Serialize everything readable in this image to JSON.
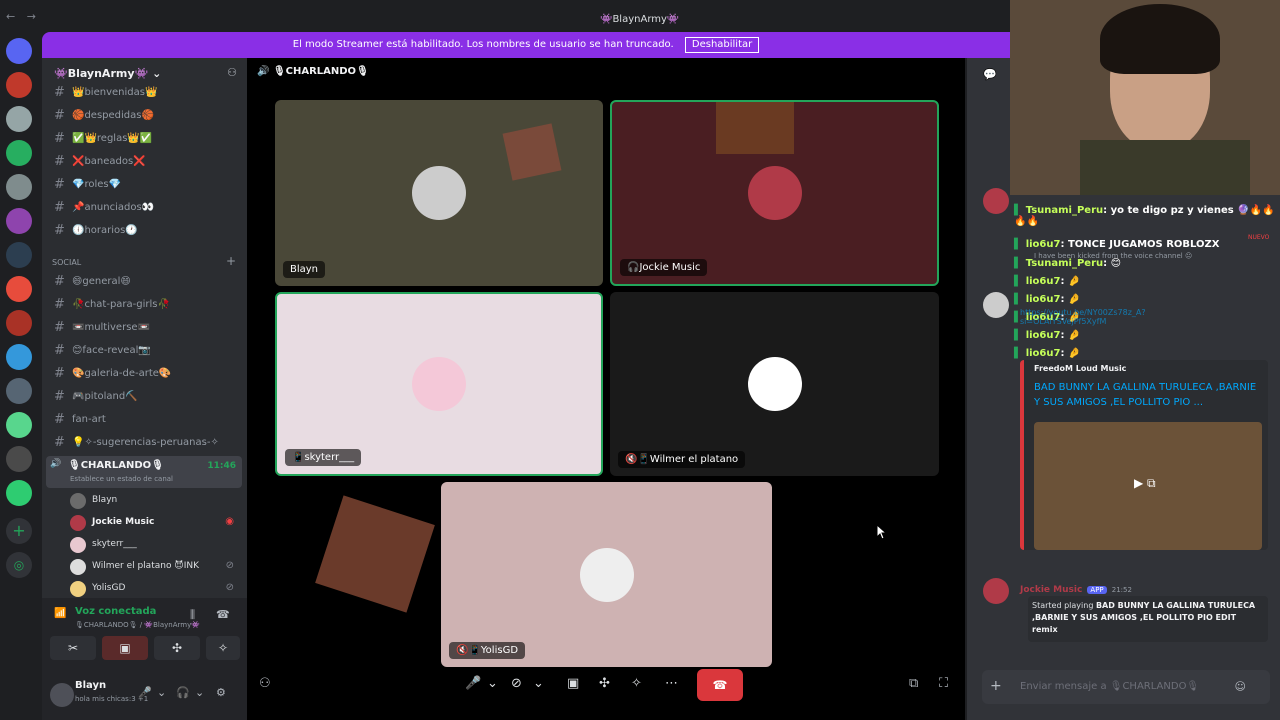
{
  "titlebar": {
    "title": "👾BlaynArmy👾",
    "nav": "← →"
  },
  "banner": {
    "text": "El modo Streamer está habilitado. Los nombres de usuario se han truncado.",
    "button": "Deshabilitar"
  },
  "server": {
    "name": "👾BlaynArmy👾"
  },
  "channels": [
    {
      "label": "👑bienvenidas👑",
      "icon": "hash-icon"
    },
    {
      "label": "🏀despedidas🏀",
      "icon": "hash-icon"
    },
    {
      "label": "✅👑reglas👑✅",
      "icon": "hash-icon"
    },
    {
      "label": "❌baneados❌",
      "icon": "hash-icon"
    },
    {
      "label": "💎roles💎",
      "icon": "hash-icon"
    },
    {
      "label": "📌anunciados👀",
      "icon": "hash-icon"
    },
    {
      "label": "🕕horarios🕐",
      "icon": "hash-icon"
    }
  ],
  "category_social": "SOCIAL",
  "social_channels": [
    {
      "label": "😄general😄",
      "icon": "hash-icon"
    },
    {
      "label": "🥀chat-para-girls🥀",
      "icon": "hash-icon"
    },
    {
      "label": "📼multiverse📼",
      "icon": "hash-icon"
    },
    {
      "label": "😊face-reveal📷",
      "icon": "hash-icon"
    },
    {
      "label": "🎨galeria-de-arte🎨",
      "icon": "hash-icon"
    },
    {
      "label": "🎮pitoland⛏️",
      "icon": "hash-icon"
    },
    {
      "label": "fan-art",
      "icon": "hash-icon"
    },
    {
      "label": "💡✧-sugerencias-peruanas-✧",
      "icon": "hash-icon"
    }
  ],
  "voice_channel": {
    "name": "🎙CHARLANDO🎙",
    "time": "11:46",
    "status": "Establece un estado de canal",
    "users": [
      {
        "name": "Blayn"
      },
      {
        "name": "Jockie Music"
      },
      {
        "name": "skyterr___"
      },
      {
        "name": "Wilmer el platano 😈INK"
      },
      {
        "name": "YolisGD"
      }
    ]
  },
  "voicebar": {
    "label": "Voz conectada",
    "sub": "🎙CHARLANDO🎙 / 👾BlaynArmy👾"
  },
  "userbar": {
    "name": "Blayn",
    "status": "hola mis chicas:3 +1"
  },
  "stage": {
    "header": "🎙CHARLANDO🎙",
    "tiles": [
      {
        "label": "Blayn"
      },
      {
        "label": "🎧Jockie Music"
      },
      {
        "label": "📱skyterr___"
      },
      {
        "label": "🔇📱Wilmer el platano"
      },
      {
        "label": "🔇📱YolisGD"
      }
    ]
  },
  "overlay_chat": [
    {
      "user": "Tsunami_Peru",
      "text": ": yo te digo pz y vienes 🔮🔥🔥🔥🔥"
    },
    {
      "user": "lio6u7",
      "text": ": TONCE JUGAMOS ROBLOZX"
    },
    {
      "user": "Tsunami_Peru",
      "text": ": 😊"
    },
    {
      "user": "lio6u7",
      "text": ": 🤌"
    },
    {
      "user": "lio6u7",
      "text": ": 🤌"
    },
    {
      "user": "lio6u7",
      "text": ": 🤌"
    },
    {
      "user": "lio6u7",
      "text": ": 🤌"
    },
    {
      "user": "lio6u7",
      "text": ": 🤌"
    }
  ],
  "chat_faded": {
    "kicked": "I have been kicked from the voice channel 😐",
    "link": "https://youtu.be/NY00Zs78z_A?si=OLAiYSVejPf5XyfM",
    "new_badge": "NUEVO"
  },
  "embed": {
    "provider": "FreedoM Loud Music",
    "title": "BAD BUNNY LA GALLINA TURULECA ,BARNIE Y SUS AMIGOS ,EL POLLITO PIO ..."
  },
  "bot_msg": {
    "name": "Jockie Music",
    "badge": "APP",
    "time": "21:52",
    "text_prefix": "Started playing ",
    "text_bold": "BAD BUNNY LA GALLINA TURULECA ,BARNIE Y SUS AMIGOS ,EL POLLITO PIO EDIT remix"
  },
  "chat_input": {
    "placeholder": "Enviar mensaje a 🎙CHARLANDO🎙"
  },
  "colors": {
    "accent": "#8a2fe6",
    "speaking": "#23a55a",
    "danger": "#da373c",
    "link": "#00a8fc"
  }
}
